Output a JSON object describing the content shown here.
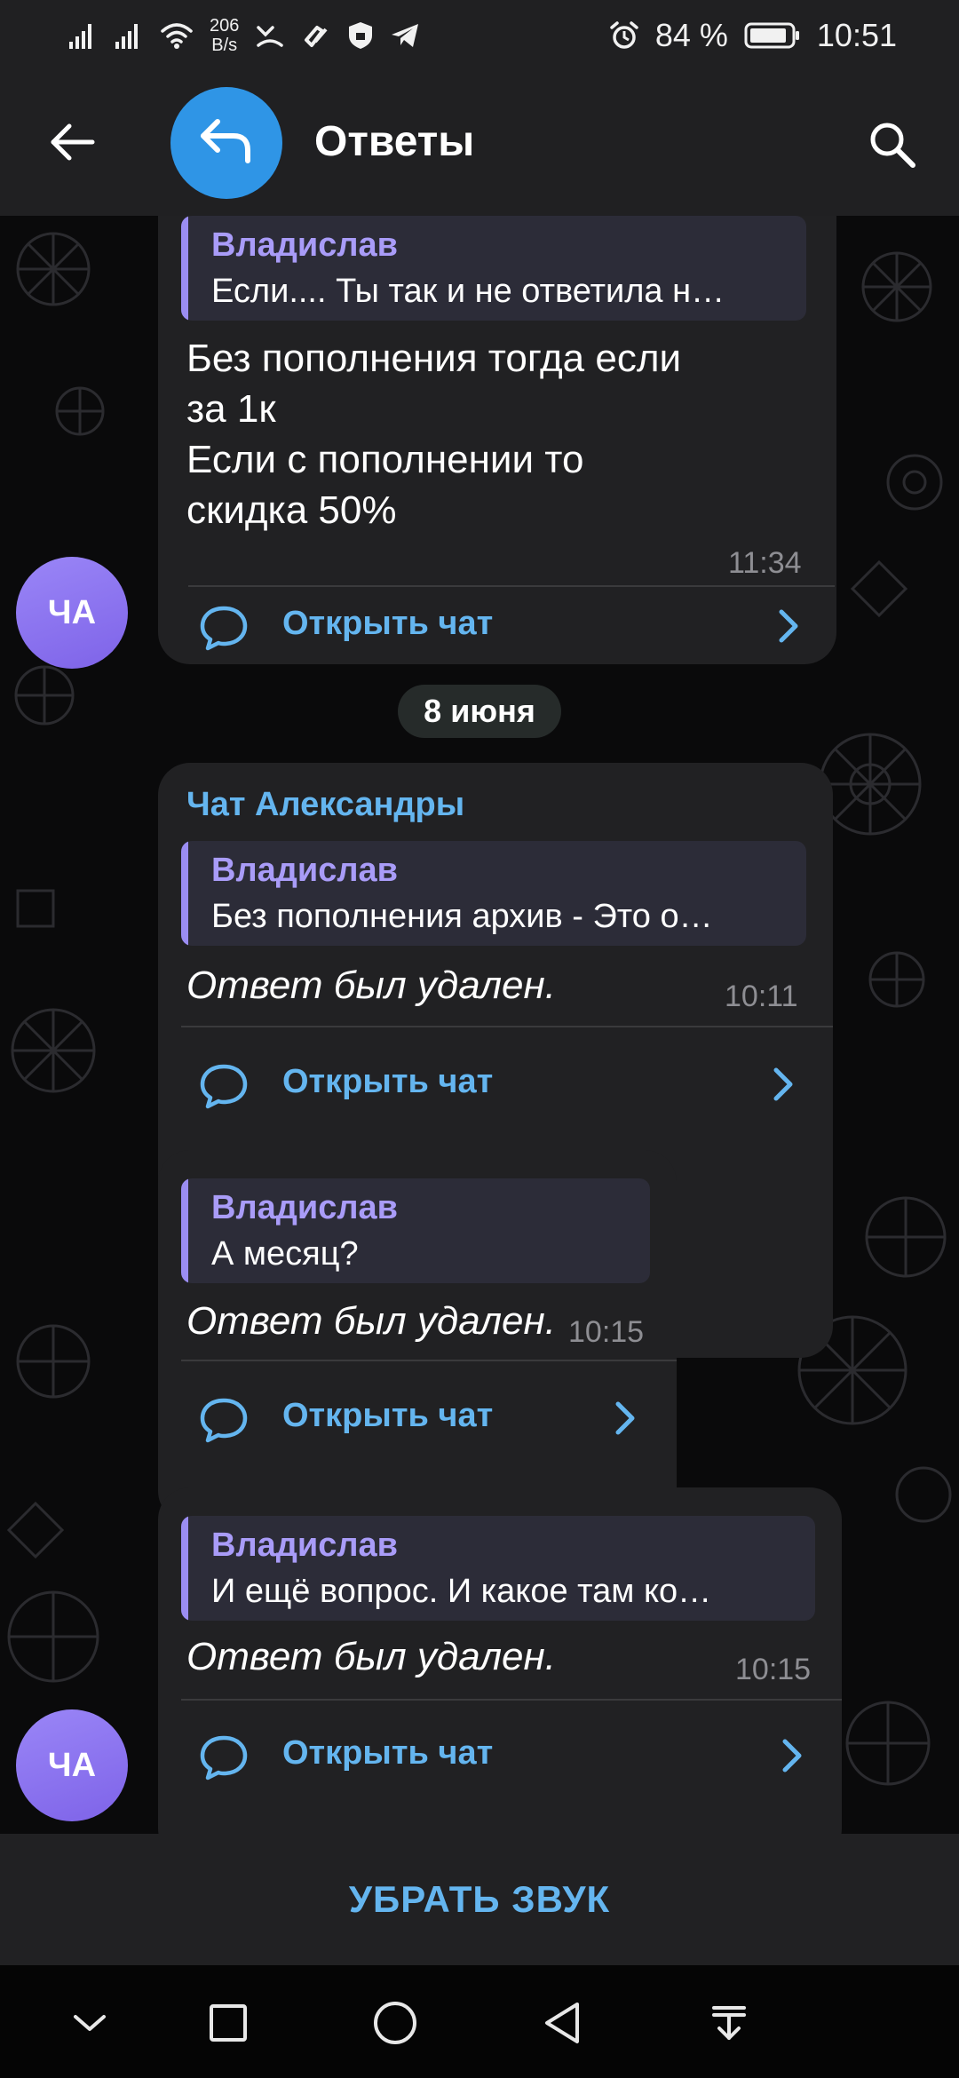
{
  "status_bar": {
    "net_speed_value": "206",
    "net_speed_unit": "B/s",
    "battery": "84 %",
    "time": "10:51"
  },
  "header": {
    "title": "Ответы"
  },
  "date_separator": "8 июня",
  "messages": [
    {
      "quote_name": "Владислав",
      "quote_text": "Если....  Ты так и не ответила н…",
      "text_lines": [
        "Без пополнения тогда если",
        "за 1к",
        "Если с пополнении то",
        "скидка 50%"
      ],
      "time": "11:34",
      "open_chat": "Открыть чат",
      "avatar": "ЧА"
    },
    {
      "sender": "Чат Александры",
      "quote_name": "Владислав",
      "quote_text": "Без пополнения архив - Это о…",
      "text": "Ответ был удален.",
      "time": "10:11",
      "open_chat": "Открыть чат"
    },
    {
      "quote_name": "Владислав",
      "quote_text": "А месяц?",
      "text": "Ответ был удален.",
      "time": "10:15",
      "open_chat": "Открыть чат"
    },
    {
      "quote_name": "Владислав",
      "quote_text": "И ещё  вопрос.  И какое там ко…",
      "text": "Ответ был удален.",
      "time": "10:15",
      "open_chat": "Открыть чат",
      "avatar": "ЧА"
    }
  ],
  "mute_button": "УБРАТЬ ЗВУК",
  "colors": {
    "accent": "#64b5ef",
    "quote_name": "#a99cf8",
    "bubble": "#212123",
    "avatar": "#8b72f0",
    "header_avatar": "#2f95e6"
  },
  "icons": {
    "status_left": [
      "signal-icon",
      "signal-icon",
      "wifi-icon",
      "missed-call-icon",
      "huawei-health-icon",
      "vpn-shield-icon",
      "telegram-icon"
    ],
    "status_right": [
      "alarm-icon",
      "battery-icon"
    ],
    "header": [
      "back-arrow-icon",
      "reply-icon",
      "search-icon"
    ],
    "open_chat": [
      "chat-bubble-icon",
      "chevron-right-icon"
    ],
    "nav": [
      "chevron-down-icon",
      "recents-square-icon",
      "home-circle-icon",
      "back-triangle-icon",
      "notification-down-icon"
    ]
  }
}
